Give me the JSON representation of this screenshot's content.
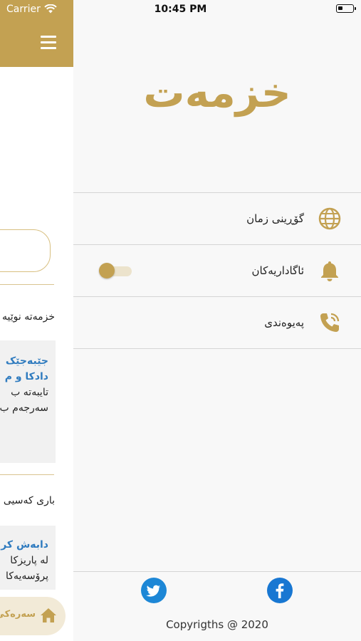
{
  "status_bar": {
    "carrier": "Carrier",
    "time": "10:45 PM"
  },
  "main_page": {
    "section_new_services": "خزمەتە نوێیە",
    "card1": {
      "title_line1": "جێبەجێک",
      "title_line2": "دادکا و م",
      "text_line1": "تایبەتە ب",
      "text_line2": "سەرجەم ب"
    },
    "section_personal": "باری کەسیی",
    "card2": {
      "title_line1": "دابەش کر",
      "text_line1": "لە پاریزکا",
      "text_line2": "پرۆسەیەکا"
    },
    "home_label": "سەرەکی"
  },
  "drawer": {
    "title": "خزمەت",
    "menu": [
      {
        "label": "گۆڕینی زمان",
        "icon": "globe-icon"
      },
      {
        "label": "ئاگاداریەکان",
        "icon": "bell-icon",
        "toggle": "off"
      },
      {
        "label": "پەیوەندی",
        "icon": "phone-icon"
      }
    ],
    "footer": {
      "social": [
        "twitter-icon",
        "facebook-icon"
      ],
      "copyright": "Copyrigths @ 2020"
    }
  },
  "colors": {
    "brand_gold": "#c3a152",
    "twitter_blue": "#1d87d6",
    "facebook_blue": "#1877d2",
    "card_title_blue": "#2f7bbf"
  }
}
